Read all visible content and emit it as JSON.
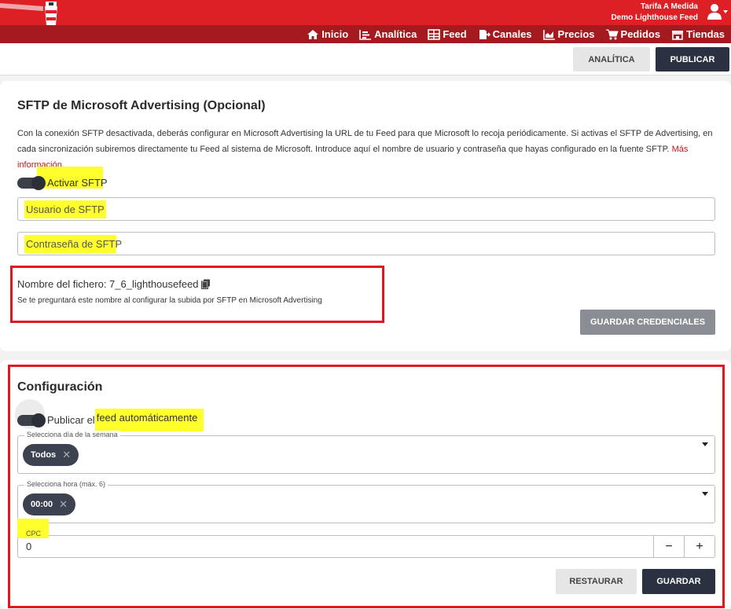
{
  "header": {
    "user_name": "Tarifa A Medida",
    "account": "Demo Lighthouse Feed"
  },
  "nav": [
    {
      "label": "Inicio",
      "icon": "home-icon"
    },
    {
      "label": "Analítica",
      "icon": "chart-icon"
    },
    {
      "label": "Feed",
      "icon": "grid-icon"
    },
    {
      "label": "Canales",
      "icon": "export-icon"
    },
    {
      "label": "Precios",
      "icon": "price-chart-icon"
    },
    {
      "label": "Pedidos",
      "icon": "cart-icon"
    },
    {
      "label": "Tiendas",
      "icon": "store-icon"
    }
  ],
  "actions": {
    "analytics": "ANALÍTICA",
    "publish": "PUBLICAR"
  },
  "sftp": {
    "title": "SFTP de Microsoft Advertising (Opcional)",
    "description": "Con la conexión SFTP desactivada, deberás configurar en Microsoft Advertising la URL de tu Feed para que Microsoft lo recoja periódicamente. Si activas el SFTP de Advertising, en cada sincronización subiremos directamente tu Feed al sistema de Microsoft. Introduce aquí el nombre de usuario y contraseña que hayas configurado en la fuente SFTP.",
    "more_link": "Más información.",
    "toggle_label": "Activar SFTP",
    "user_placeholder": "Usuario de SFTP",
    "password_placeholder": "Contraseña de SFTP",
    "filename_label": "Nombre del fichero: 7_6_lighthousefeed",
    "filename_help": "Se te preguntará este nombre al configurar la subida por SFTP en Microsoft Advertising",
    "save_credentials": "GUARDAR CREDENCIALES"
  },
  "config": {
    "title": "Configuración",
    "toggle_prefix": "Publicar el ",
    "toggle_highlight": "feed automáticamente",
    "day_label": "Selecciona día de la semana",
    "day_chip": "Todos",
    "hour_label": "Selecciona hora (máx. 6)",
    "hour_chip": "00:00",
    "cpc_label": "CPC",
    "cpc_value": "0",
    "minus": "−",
    "plus": "+",
    "restore": "RESTAURAR",
    "save": "GUARDAR"
  },
  "colors": {
    "brand_red": "#dd1f26",
    "nav_dark_red": "#a51a1f",
    "dark_button": "#2b3140",
    "highlight_yellow": "#ffff2b"
  }
}
